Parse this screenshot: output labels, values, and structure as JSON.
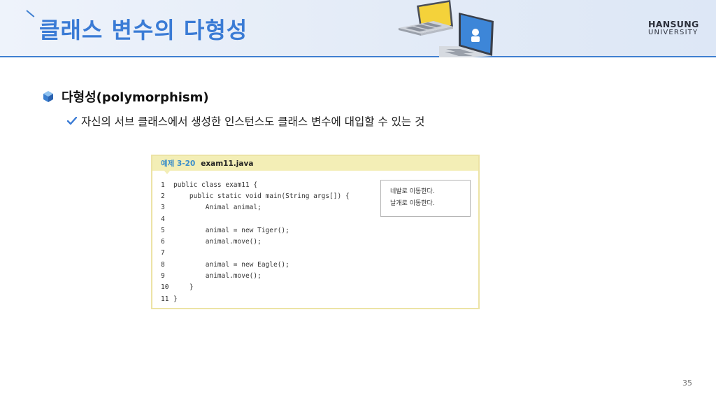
{
  "slide": {
    "title": "클래스 변수의 다형성",
    "page_number": "35"
  },
  "logo": {
    "line1": "HANSUNG",
    "line2": "UNIVERSITY"
  },
  "content": {
    "heading": "다형성(polymorphism)",
    "bullet": "자신의 서브 클래스에서 생성한 인스턴스도 클래스 변수에 대입할 수 있는 것"
  },
  "code_example": {
    "label": "예제 3-20",
    "filename": "exam11.java",
    "lines": [
      {
        "no": "1",
        "code": "public class exam11 {"
      },
      {
        "no": "2",
        "code": "    public static void main(String args[]) {"
      },
      {
        "no": "3",
        "code": "        Animal animal;"
      },
      {
        "no": "4",
        "code": ""
      },
      {
        "no": "5",
        "code": "        animal = new Tiger();"
      },
      {
        "no": "6",
        "code": "        animal.move();"
      },
      {
        "no": "7",
        "code": ""
      },
      {
        "no": "8",
        "code": "        animal = new Eagle();"
      },
      {
        "no": "9",
        "code": "        animal.move();"
      },
      {
        "no": "10",
        "code": "    }"
      },
      {
        "no": "11",
        "code": "}"
      }
    ],
    "output": [
      "네발로 이동한다.",
      "날개로 이동한다."
    ]
  },
  "colors": {
    "accent": "#3a7bd5",
    "code_header": "#f3eeb6",
    "code_border": "#ece3a5",
    "label_blue": "#3b8ec9"
  },
  "icons": {
    "bullet": "cube-icon",
    "sub_bullet": "checkmark-icon",
    "header_art": "laptops-illustration"
  }
}
